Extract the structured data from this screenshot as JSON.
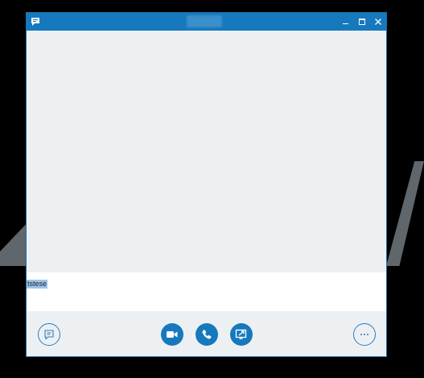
{
  "window": {
    "title": "",
    "controls": {
      "minimize_icon": "minimize-icon",
      "maximize_icon": "maximize-icon",
      "close_icon": "close-icon"
    }
  },
  "compose": {
    "value": "tstese"
  },
  "toolbar": {
    "left": {
      "icon": "im-icon"
    },
    "center": [
      {
        "icon": "video-icon"
      },
      {
        "icon": "phone-icon"
      },
      {
        "icon": "present-icon"
      }
    ],
    "right": {
      "icon": "more-options-icon"
    }
  },
  "colors": {
    "accent": "#1679bd",
    "background": "#edf0f3",
    "selection": "#9cc4e8"
  }
}
